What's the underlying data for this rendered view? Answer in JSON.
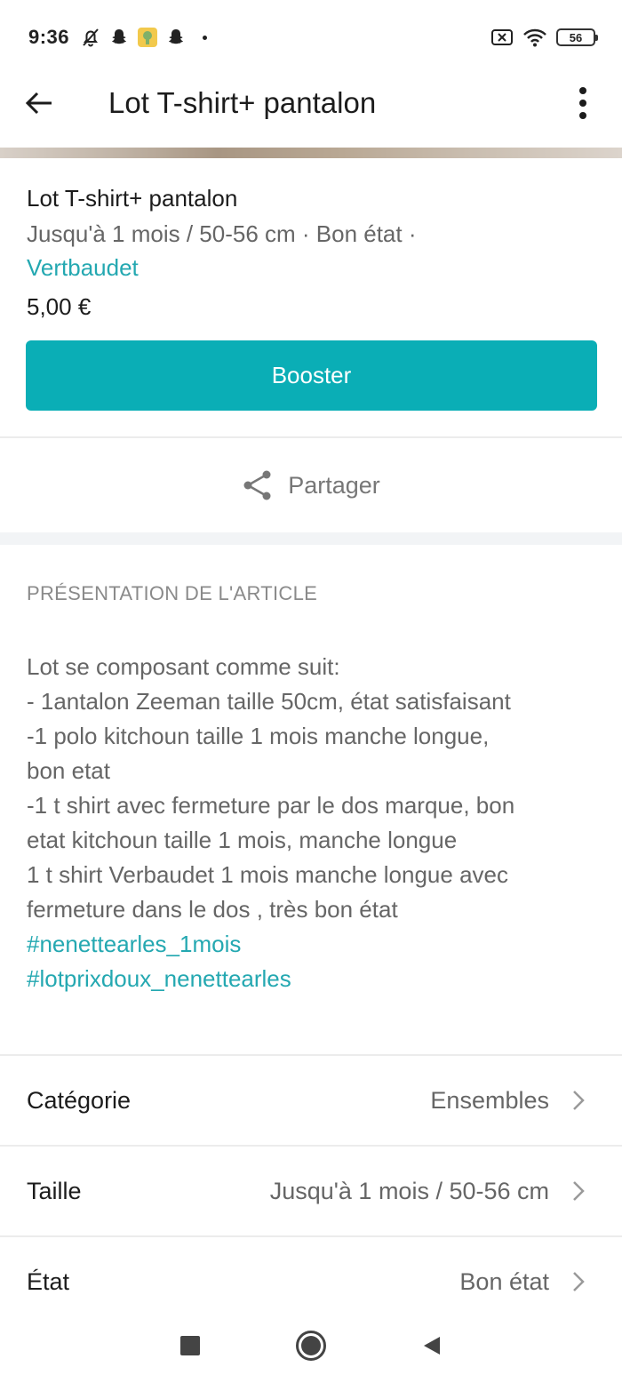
{
  "status_bar": {
    "time": "9:36",
    "battery": "56",
    "icons": [
      "bell-off-icon",
      "snapchat-icon",
      "app-icon",
      "snapchat-icon",
      "dot-icon",
      "close-box-icon",
      "wifi-icon",
      "battery-icon"
    ]
  },
  "header": {
    "title": "Lot T-shirt+ pantalon",
    "back_icon": "arrow-left-icon",
    "menu_icon": "more-vertical-icon"
  },
  "item": {
    "title": "Lot T-shirt+ pantalon",
    "meta": "Jusqu'à 1 mois / 50-56 cm · Bon état ·",
    "brand": "Vertbaudet",
    "price": "5,00 €"
  },
  "actions": {
    "booster_label": "Booster",
    "share_label": "Partager"
  },
  "description": {
    "heading": "PRÉSENTATION DE L'ARTICLE",
    "lines": [
      "Lot se composant comme suit:",
      "- 1antalon Zeeman taille 50cm, état satisfaisant",
      "-1 polo kitchoun taille 1 mois manche longue,",
      "bon etat",
      "-1 t shirt avec fermeture par le dos marque, bon",
      "etat kitchoun taille 1 mois, manche longue",
      "1 t shirt Verbaudet 1 mois manche longue avec",
      "fermeture dans le dos , très bon état"
    ],
    "hashtags": [
      "#nenettearles_1mois",
      "#lotprixdoux_nenettearles"
    ]
  },
  "attributes": [
    {
      "label": "Catégorie",
      "value": "Ensembles"
    },
    {
      "label": "Taille",
      "value": "Jusqu'à 1 mois / 50-56 cm"
    },
    {
      "label": "État",
      "value": "Bon état"
    }
  ],
  "colors": {
    "accent": "#0aaeb6",
    "link": "#24a8b1"
  }
}
